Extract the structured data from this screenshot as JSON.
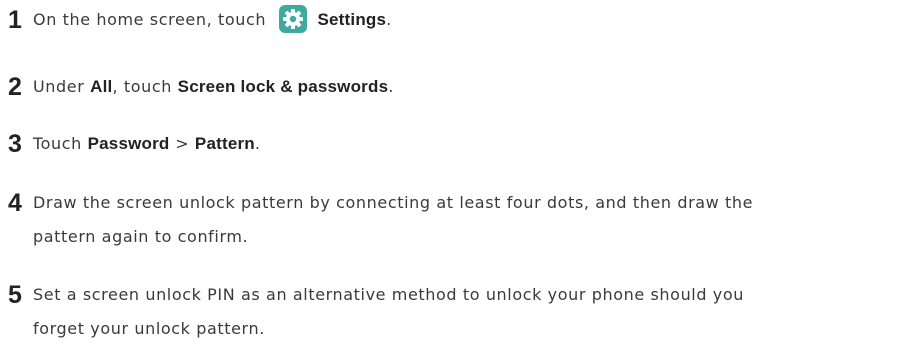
{
  "steps": [
    {
      "number": "1",
      "prefix": "On the home screen, touch",
      "icon": "settings-gear-icon",
      "bold1": "Settings",
      "suffix": "."
    },
    {
      "number": "2",
      "prefix": "Under",
      "bold1": "All",
      "middle": ", touch",
      "bold2": "Screen lock & passwords",
      "suffix": "."
    },
    {
      "number": "3",
      "prefix": "Touch",
      "bold1": "Password",
      "middle": ">",
      "bold2": "Pattern",
      "suffix": "."
    },
    {
      "number": "4",
      "line1": "Draw the screen unlock pattern by connecting at least four dots, and then draw the",
      "line2": "pattern again to confirm."
    },
    {
      "number": "5",
      "line1": "Set a screen unlock PIN as an alternative method to unlock your phone should you",
      "line2": "forget your unlock pattern."
    }
  ],
  "colors": {
    "icon_bg": "#3fa9a0",
    "icon_fg": "#ffffff"
  }
}
